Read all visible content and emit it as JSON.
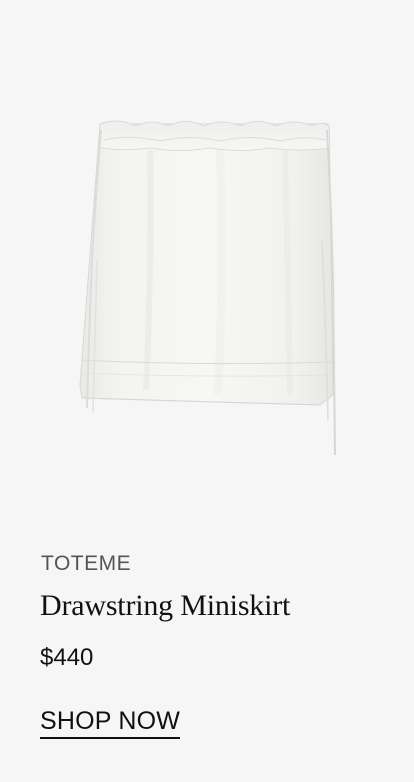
{
  "product": {
    "brand": "TOTEME",
    "name": "Drawstring Miniskirt",
    "price": "$440",
    "cta_label": "SHOP NOW",
    "image_subject": "white drawstring miniskirt"
  },
  "colors": {
    "background": "#f6f6f6",
    "text": "#111111",
    "brand_text": "#555555"
  }
}
